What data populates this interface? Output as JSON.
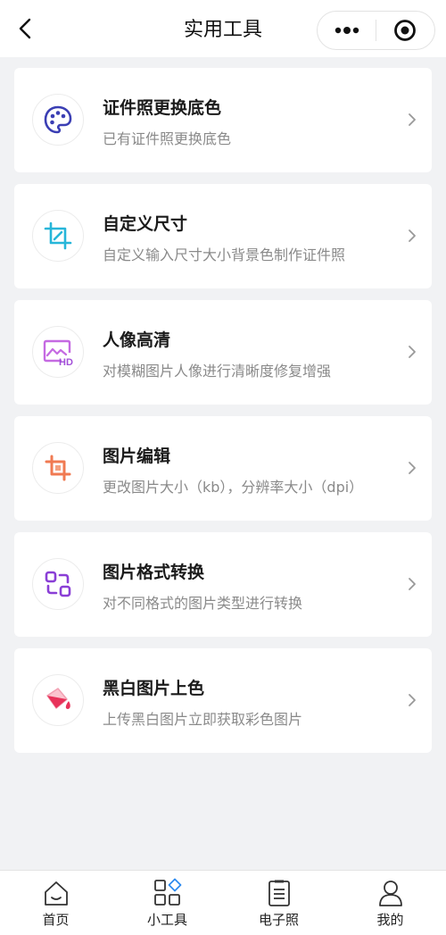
{
  "header": {
    "title": "实用工具",
    "back_icon": "chevron-left-icon",
    "more_icon": "more-dots-icon",
    "close_icon": "target-circle-icon"
  },
  "tools": [
    {
      "title": "证件照更换底色",
      "desc": "已有证件照更换底色",
      "icon": "palette-icon",
      "color": "#3b3fb4"
    },
    {
      "title": "自定义尺寸",
      "desc": "自定义输入尺寸大小背景色制作证件照",
      "icon": "crop-icon",
      "color": "#27b6d9"
    },
    {
      "title": "人像高清",
      "desc": "对模糊图片人像进行清晰度修复增强",
      "icon": "hd-image-icon",
      "color": "#b561e0"
    },
    {
      "title": "图片编辑",
      "desc": "更改图片大小（kb），分辨率大小（dpi）",
      "icon": "crop-square-icon",
      "color": "#f07a52"
    },
    {
      "title": "图片格式转换",
      "desc": "对不同格式的图片类型进行转换",
      "icon": "convert-icon",
      "color": "#8a3fd6"
    },
    {
      "title": "黑白图片上色",
      "desc": "上传黑白图片立即获取彩色图片",
      "icon": "paint-bucket-icon",
      "color": "#e8325a"
    }
  ],
  "tabbar": {
    "tabs": [
      {
        "label": "首页",
        "icon": "home-icon"
      },
      {
        "label": "小工具",
        "icon": "grid-diamond-icon"
      },
      {
        "label": "电子照",
        "icon": "clipboard-icon"
      },
      {
        "label": "我的",
        "icon": "user-icon"
      }
    ]
  }
}
